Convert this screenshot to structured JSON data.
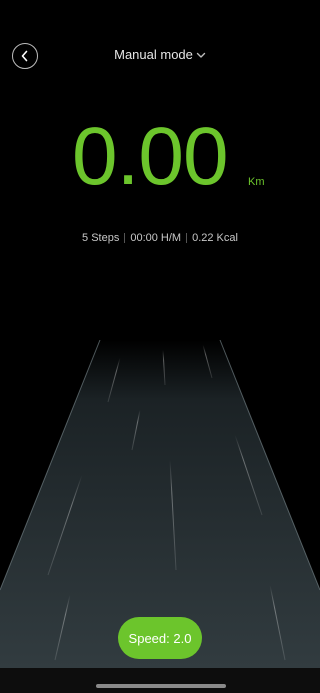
{
  "header": {
    "mode_label": "Manual mode"
  },
  "metrics": {
    "distance_value": "0.00",
    "distance_unit": "Km",
    "steps": "5 Steps",
    "time": "00:00 H/M",
    "calories": "0.22 Kcal"
  },
  "controls": {
    "speed_label": "Speed: 2.0"
  },
  "icons": {
    "back": "chevron-left-icon",
    "dropdown": "chevron-down-icon"
  },
  "colors": {
    "accent": "#6cc52c",
    "background": "#000000",
    "track": "#2f3a3d"
  }
}
